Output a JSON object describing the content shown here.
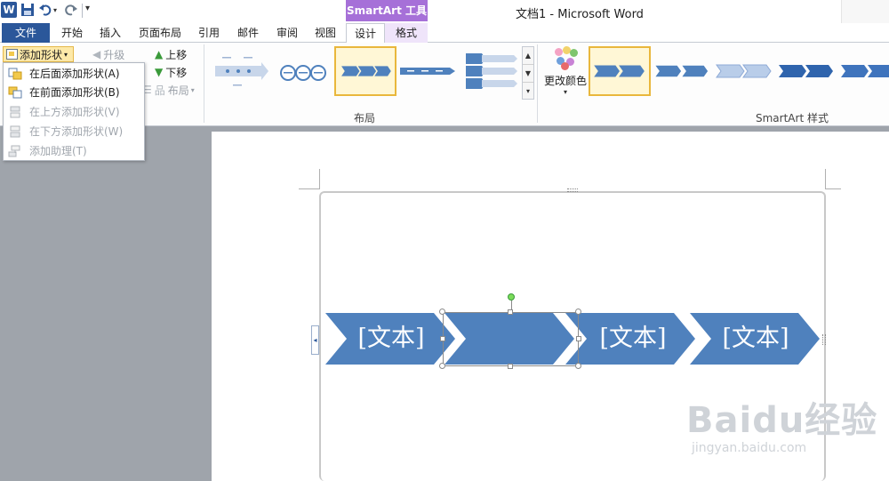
{
  "window": {
    "title": "文档1 - Microsoft Word",
    "contextual_group": "SmartArt 工具"
  },
  "quick_access": {
    "word_logo": "W",
    "undo_dropdown": "▾",
    "customize": "▾"
  },
  "tabs": [
    {
      "label": "文件"
    },
    {
      "label": "开始"
    },
    {
      "label": "插入"
    },
    {
      "label": "页面布局"
    },
    {
      "label": "引用"
    },
    {
      "label": "邮件"
    },
    {
      "label": "审阅"
    },
    {
      "label": "视图"
    },
    {
      "label": "设计"
    },
    {
      "label": "格式"
    }
  ],
  "ribbon": {
    "create_graphic": {
      "add_shape": "添加形状",
      "promote": "升级",
      "move_up": "上移",
      "move_down": "下移",
      "layout": "布局"
    },
    "layouts_group_label": "布局",
    "change_colors": "更改颜色",
    "styles_group_label": "SmartArt 样式"
  },
  "add_shape_menu": [
    {
      "label": "在后面添加形状(A)",
      "enabled": true
    },
    {
      "label": "在前面添加形状(B)",
      "enabled": true
    },
    {
      "label": "在上方添加形状(V)",
      "enabled": false
    },
    {
      "label": "在下方添加形状(W)",
      "enabled": false
    },
    {
      "label": "添加助理(T)",
      "enabled": false
    }
  ],
  "smartart": {
    "shape_text": [
      "[文本]",
      "",
      "[文本]",
      "[文本]"
    ],
    "fill_color": "#4f81bd",
    "selected_index": 1
  },
  "watermark": {
    "main": "Baidu经验",
    "sub": "jingyan.baidu.com"
  },
  "colors": {
    "accent": "#2b579a",
    "contextual": "#a670d8",
    "selection": "#e9b73c"
  }
}
